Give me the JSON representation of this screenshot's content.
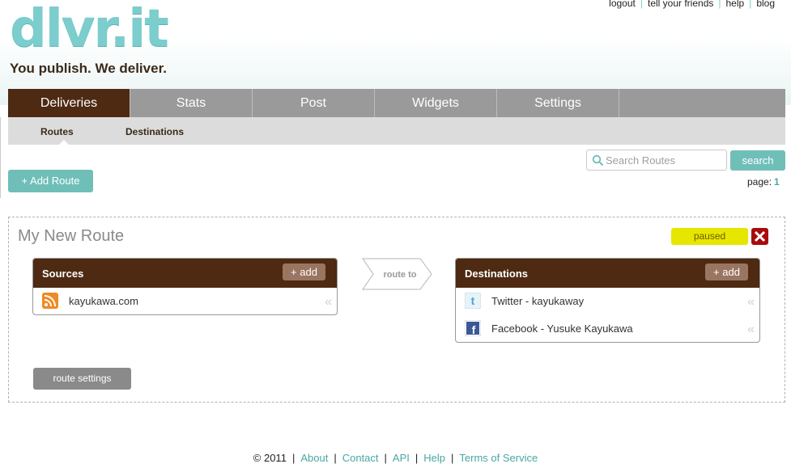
{
  "brand": {
    "logo_text": "dlvr.it",
    "tagline": "You publish. We deliver.",
    "logo_color": "#7ccdcd"
  },
  "top_links": [
    "logout",
    "tell your friends",
    "help",
    "blog"
  ],
  "tabs": [
    {
      "label": "Deliveries",
      "active": true
    },
    {
      "label": "Stats"
    },
    {
      "label": "Post"
    },
    {
      "label": "Widgets"
    },
    {
      "label": "Settings"
    }
  ],
  "subnav": {
    "routes": "Routes",
    "destinations": "Destinations"
  },
  "actions": {
    "add_route": "+ Add Route",
    "search_placeholder": "Search Routes",
    "search_button": "search",
    "page_label": "page:",
    "page_number": "1"
  },
  "route": {
    "name": "My New Route",
    "status": "paused",
    "route_to": "route to",
    "settings_button": "route settings",
    "sources": {
      "title": "Sources",
      "add_label": "+ add",
      "items": [
        {
          "label": "kayukawa.com",
          "icon": "rss-icon"
        }
      ]
    },
    "destinations": {
      "title": "Destinations",
      "add_label": "+ add",
      "items": [
        {
          "label": "Twitter - kayukaway",
          "icon": "twitter-icon"
        },
        {
          "label": "Facebook - Yusuke Kayukawa",
          "icon": "facebook-icon"
        }
      ]
    }
  },
  "footer": {
    "copyright": "© 2011",
    "links": [
      "About",
      "Contact",
      "API",
      "Help",
      "Terms of Service"
    ]
  },
  "colors": {
    "tab_active": "#4e2a12",
    "tab_inactive": "#9a9a9a",
    "accent": "#6fbfb8",
    "paused": "#e6e600",
    "delete": "#a80c0c"
  }
}
